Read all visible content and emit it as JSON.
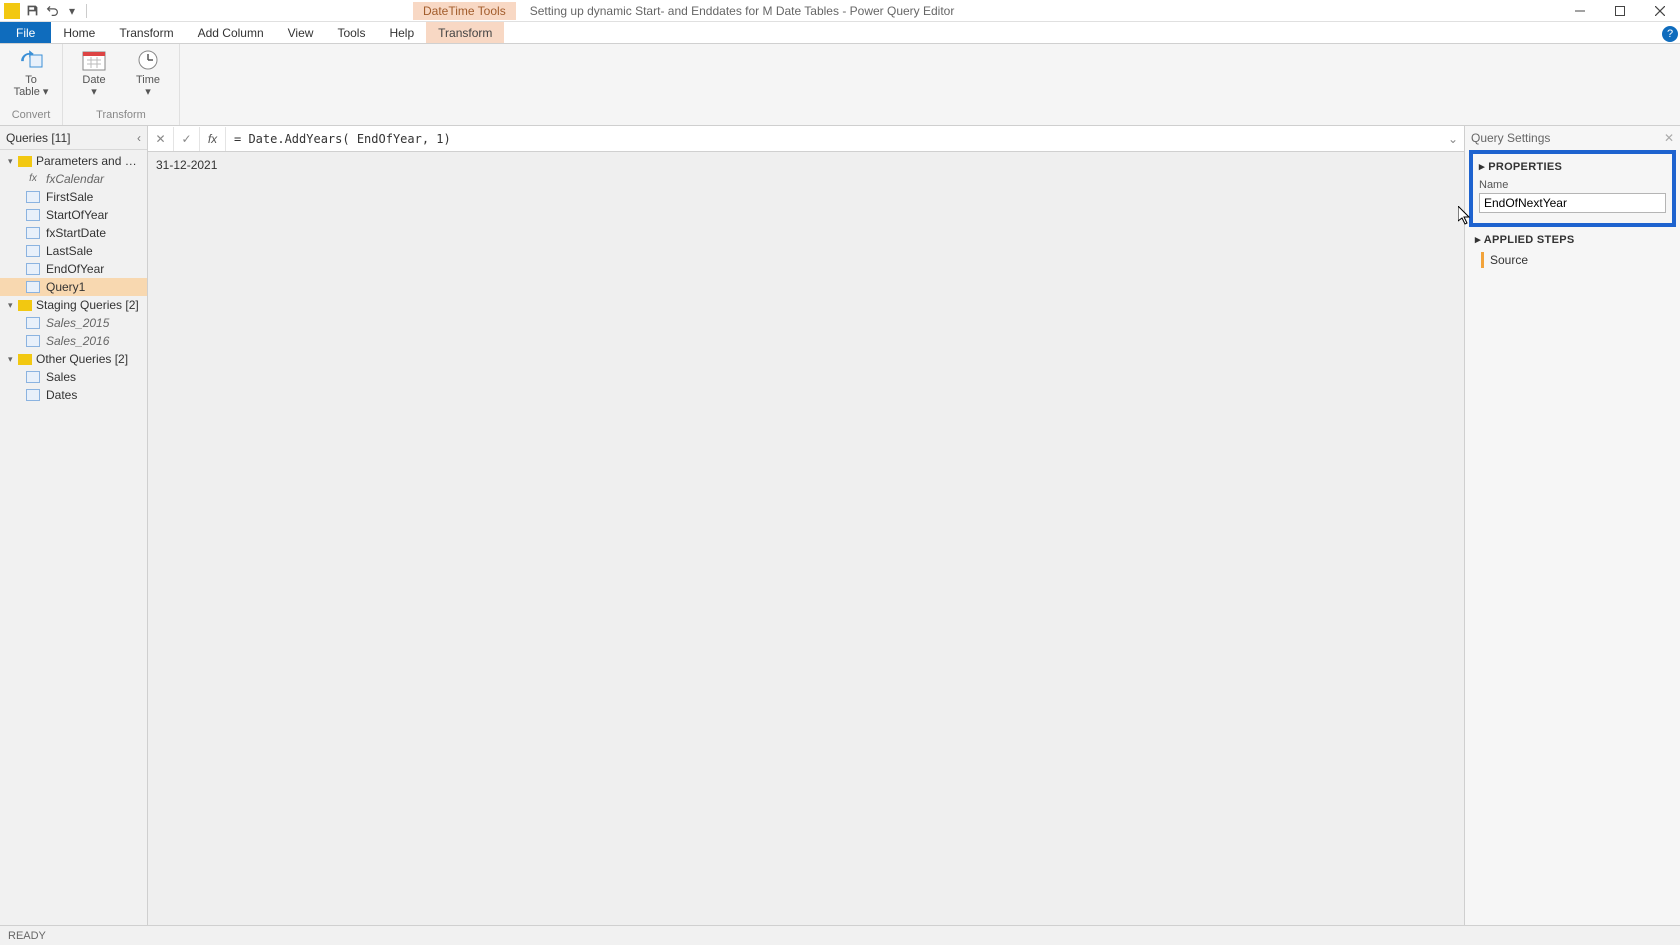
{
  "titlebar": {
    "contextual_tab": "DateTime Tools",
    "window_title": "Setting up dynamic Start- and Enddates for M Date Tables - Power Query Editor"
  },
  "ribbon_tabs": {
    "file": "File",
    "home": "Home",
    "transform": "Transform",
    "add_column": "Add Column",
    "view": "View",
    "tools": "Tools",
    "help": "Help",
    "context_transform": "Transform"
  },
  "ribbon": {
    "convert": {
      "to_table": "To\nTable ▾",
      "group_label": "Convert"
    },
    "transform": {
      "date": "Date\n▾",
      "time": "Time\n▾",
      "group_label": "Transform"
    }
  },
  "queries_panel": {
    "header": "Queries [11]",
    "folders": [
      {
        "label": "Parameters and Fu…",
        "expanded": true,
        "items": [
          {
            "icon": "fx",
            "label": "fxCalendar",
            "italic": true
          },
          {
            "icon": "tbl",
            "label": "FirstSale"
          },
          {
            "icon": "tbl",
            "label": "StartOfYear"
          },
          {
            "icon": "tbl",
            "label": "fxStartDate"
          },
          {
            "icon": "tbl",
            "label": "LastSale"
          },
          {
            "icon": "tbl",
            "label": "EndOfYear"
          },
          {
            "icon": "tbl",
            "label": "Query1",
            "selected": true
          }
        ]
      },
      {
        "label": "Staging Queries [2]",
        "expanded": true,
        "items": [
          {
            "icon": "tbl",
            "label": "Sales_2015",
            "italic": true
          },
          {
            "icon": "tbl",
            "label": "Sales_2016",
            "italic": true
          }
        ]
      },
      {
        "label": "Other Queries [2]",
        "expanded": true,
        "items": [
          {
            "icon": "tbl",
            "label": "Sales"
          },
          {
            "icon": "tbl",
            "label": "Dates"
          }
        ]
      }
    ]
  },
  "formula_bar": {
    "formula": "= Date.AddYears( EndOfYear, 1)"
  },
  "data": {
    "scalar_value": "31-12-2021"
  },
  "settings_panel": {
    "header": "Query Settings",
    "properties_head": "PROPERTIES",
    "name_label": "Name",
    "name_value": "EndOfNextYear",
    "applied_head": "APPLIED STEPS",
    "steps": [
      {
        "label": "Source"
      }
    ]
  },
  "statusbar": {
    "status": "READY"
  },
  "help_badge": "?"
}
